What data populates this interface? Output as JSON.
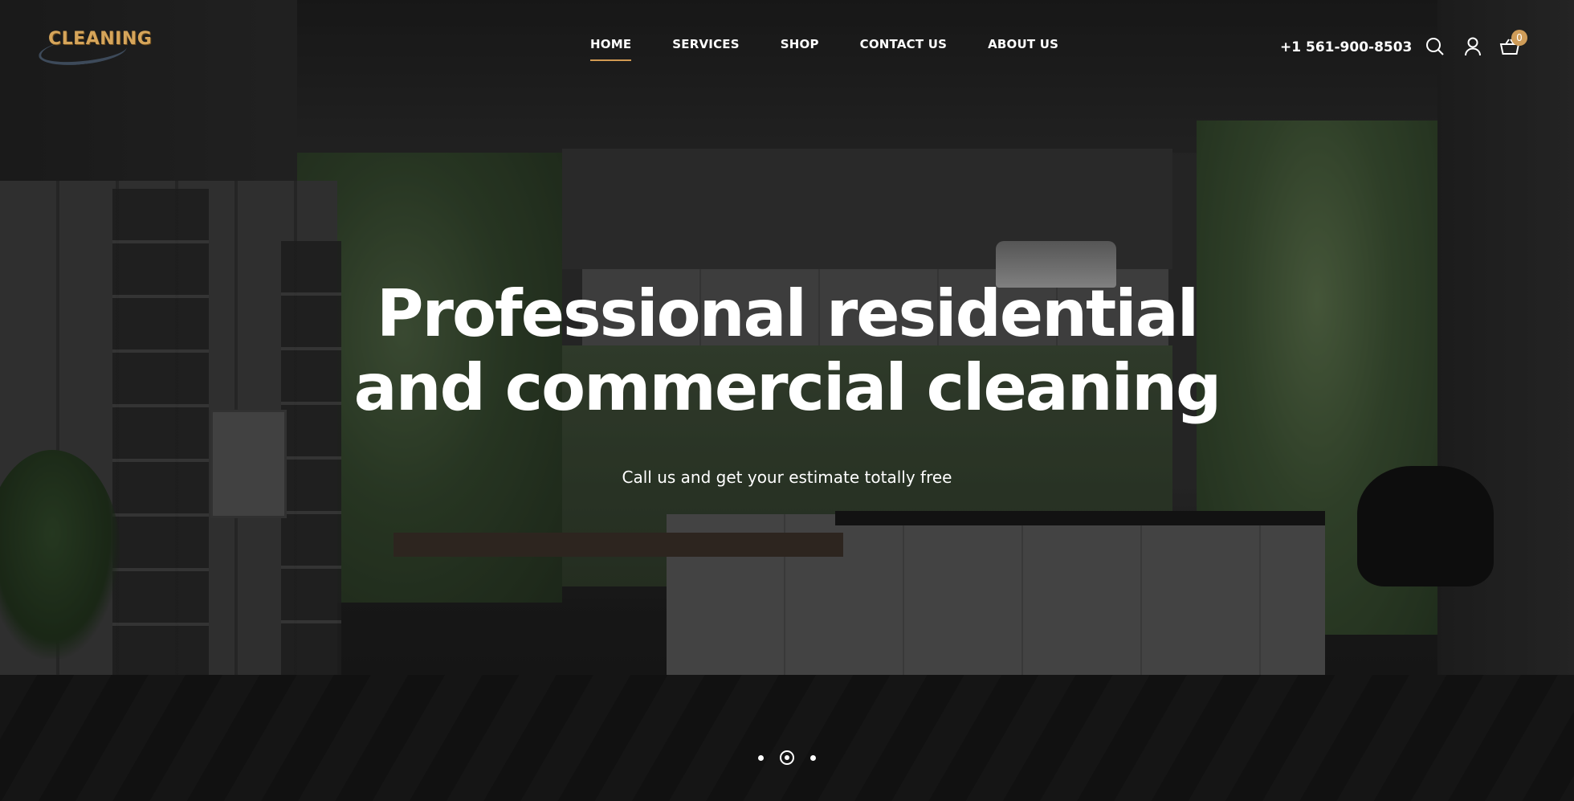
{
  "brand": {
    "logo_text": "CLEANING"
  },
  "nav": {
    "items": [
      {
        "label": "HOME",
        "active": true
      },
      {
        "label": "SERVICES",
        "active": false
      },
      {
        "label": "SHOP",
        "active": false
      },
      {
        "label": "CONTACT US",
        "active": false
      },
      {
        "label": "ABOUT US",
        "active": false
      }
    ]
  },
  "header": {
    "phone": "+1 561-900-8503",
    "icons": [
      "search-icon",
      "user-icon",
      "cart-icon"
    ],
    "cart_count": "0"
  },
  "hero": {
    "title_line1": "Professional residential",
    "title_line2": "and commercial cleaning",
    "subtitle": "Call us and get your estimate totally free"
  },
  "slider": {
    "slide_count": 3,
    "active_index": 1
  },
  "colors": {
    "accent": "#d19a52",
    "logo": "#d6a55a",
    "text": "#ffffff"
  }
}
